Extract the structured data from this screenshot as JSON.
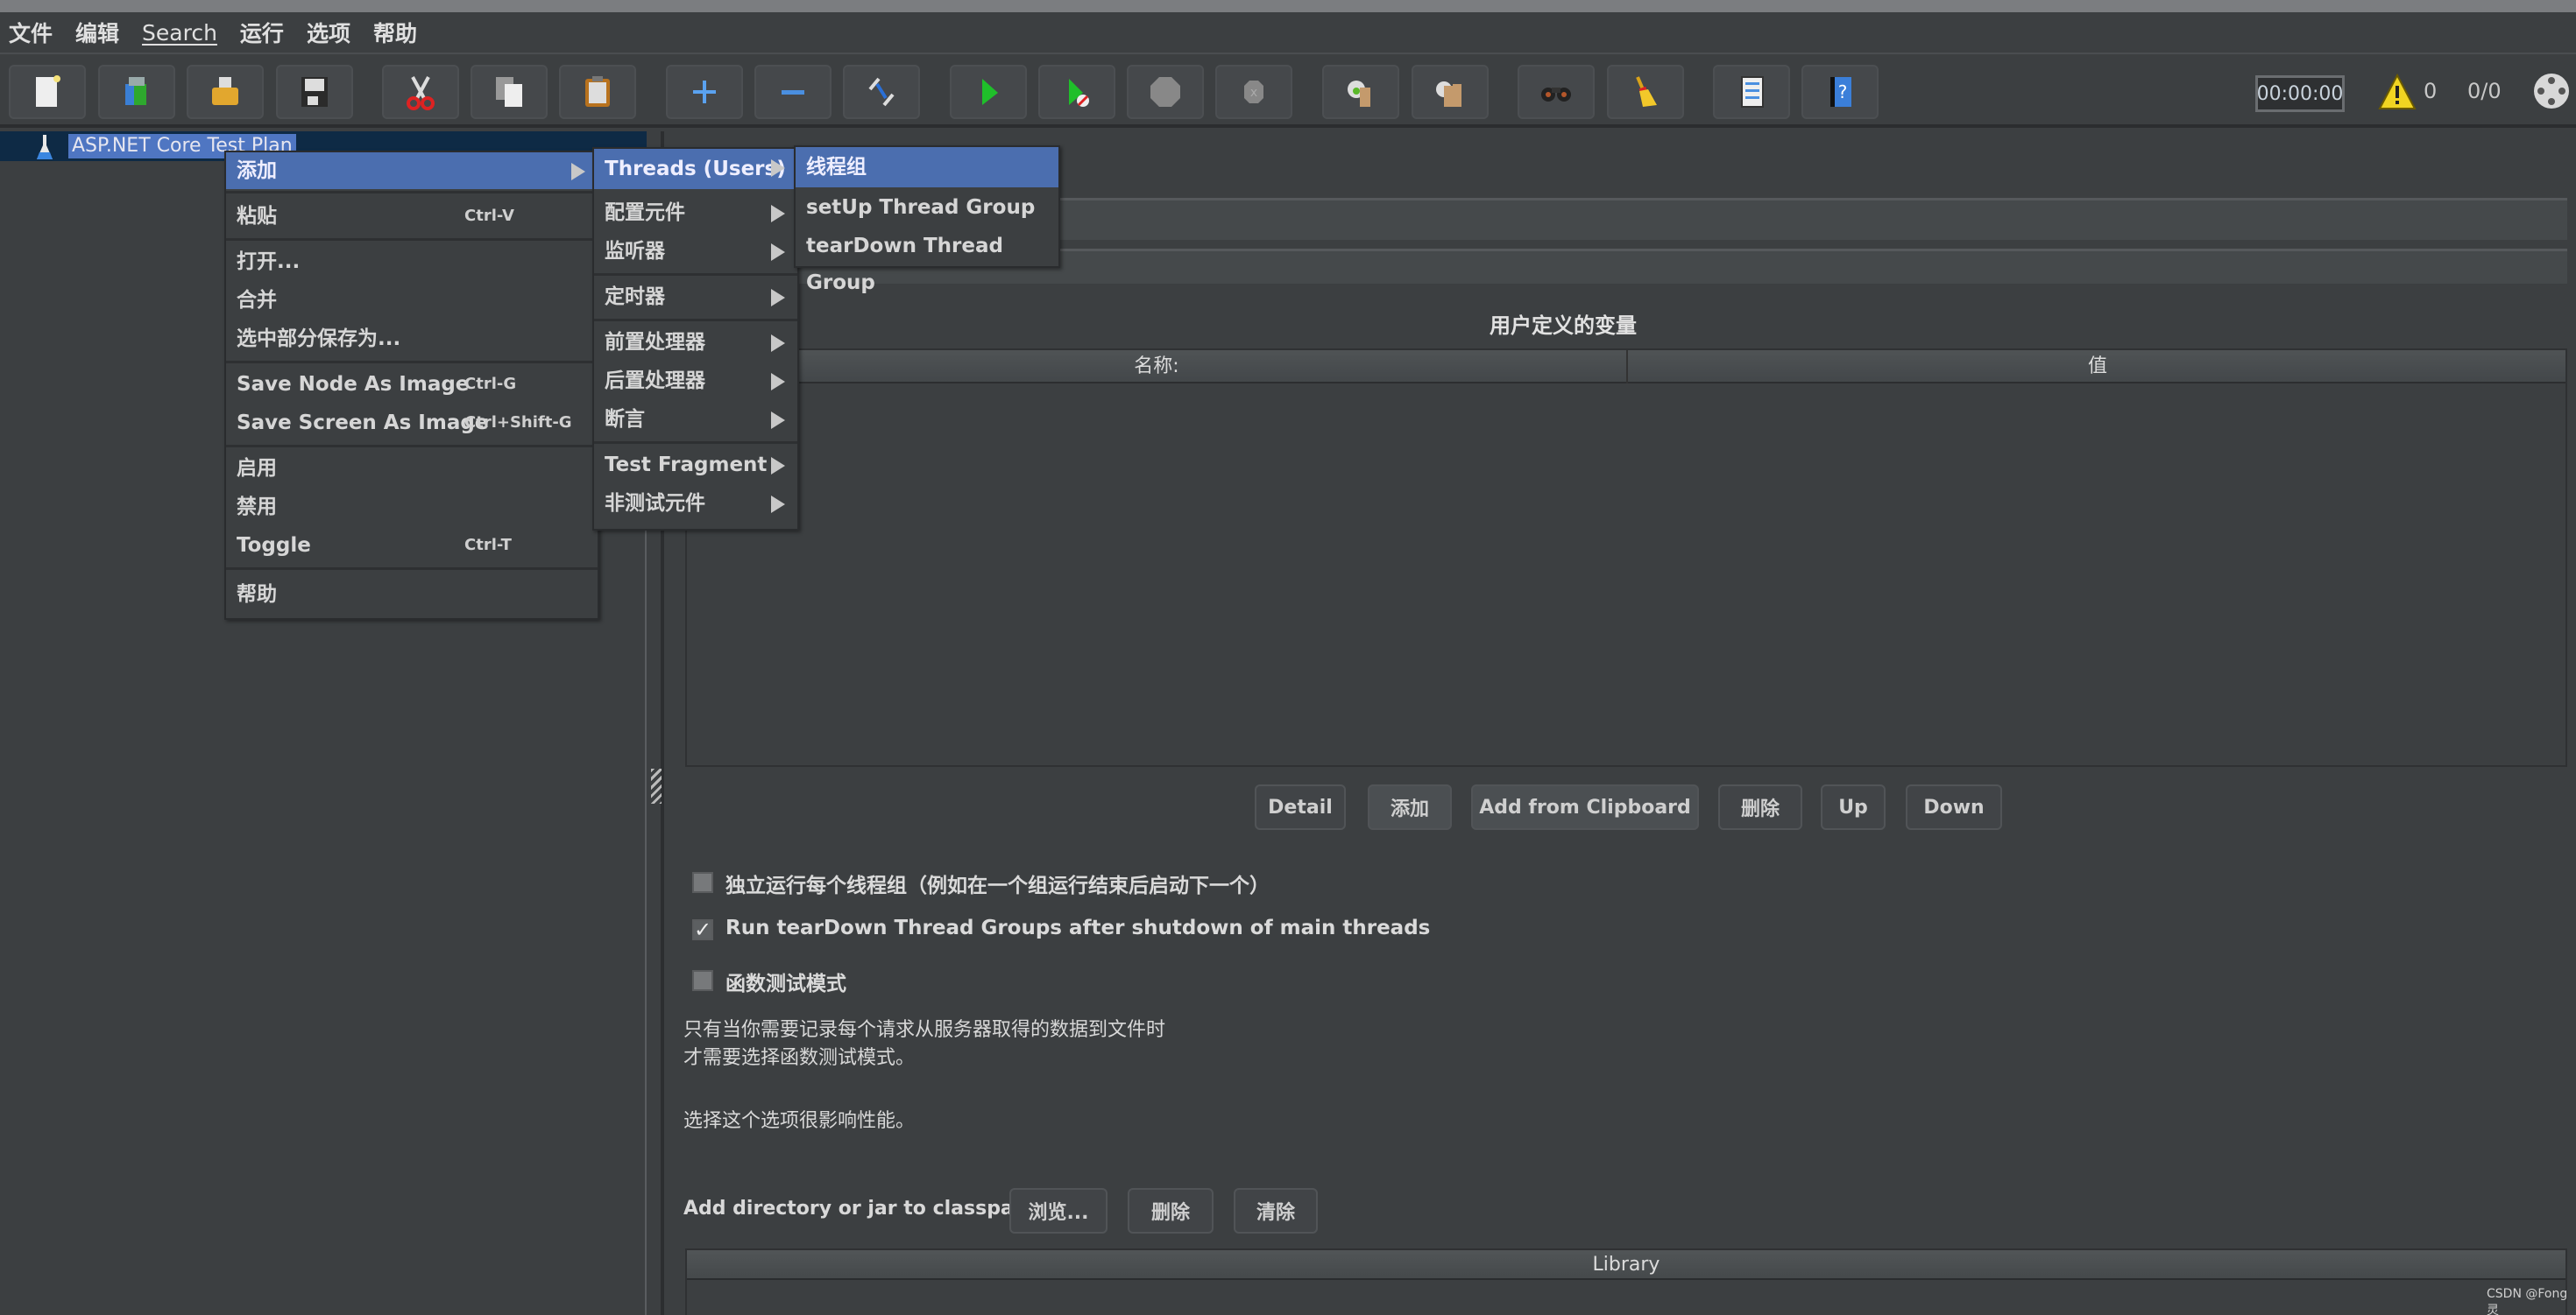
{
  "menubar": {
    "items": [
      "文件",
      "编辑",
      "Search",
      "运行",
      "选项",
      "帮助"
    ]
  },
  "toolbar": {
    "buttons": [
      {
        "name": "new",
        "icon": "new-document-icon"
      },
      {
        "name": "templates",
        "icon": "templates-icon"
      },
      {
        "name": "open",
        "icon": "open-folder-icon"
      },
      {
        "name": "save",
        "icon": "save-disk-icon"
      },
      {
        "name": "cut",
        "icon": "scissors-icon"
      },
      {
        "name": "copy",
        "icon": "copy-icon"
      },
      {
        "name": "paste",
        "icon": "clipboard-icon"
      },
      {
        "name": "expand-all",
        "icon": "plus-icon"
      },
      {
        "name": "collapse-all",
        "icon": "minus-icon"
      },
      {
        "name": "toggle",
        "icon": "toggle-wand-icon"
      },
      {
        "name": "start",
        "icon": "play-icon"
      },
      {
        "name": "start-no-pauses",
        "icon": "play-no-timers-icon"
      },
      {
        "name": "stop",
        "icon": "stop-icon"
      },
      {
        "name": "shutdown",
        "icon": "shutdown-icon"
      },
      {
        "name": "clear",
        "icon": "clear-broom-gear-icon"
      },
      {
        "name": "clear-all",
        "icon": "clear-all-broom-icon"
      },
      {
        "name": "search",
        "icon": "binoculars-icon"
      },
      {
        "name": "reset-search",
        "icon": "broom-icon"
      },
      {
        "name": "function-helper",
        "icon": "function-list-icon"
      },
      {
        "name": "help",
        "icon": "help-book-icon"
      }
    ],
    "timer": "00:00:00",
    "warning_count": "0",
    "threads_ratio": "0/0"
  },
  "tree": {
    "root_label": "ASP.NET Core Test Plan"
  },
  "context_menu": {
    "items": [
      {
        "label": "添加",
        "shortcut": "",
        "submenu": true,
        "selected": true
      },
      {
        "label": "粘贴",
        "shortcut": "Ctrl-V"
      },
      {
        "label": "打开...",
        "shortcut": ""
      },
      {
        "label": "合并",
        "shortcut": ""
      },
      {
        "label": "选中部分保存为...",
        "shortcut": ""
      },
      {
        "label": "Save Node As Image",
        "shortcut": "Ctrl-G"
      },
      {
        "label": "Save Screen As Image",
        "shortcut": "Ctrl+Shift-G"
      },
      {
        "label": "启用",
        "shortcut": ""
      },
      {
        "label": "禁用",
        "shortcut": ""
      },
      {
        "label": "Toggle",
        "shortcut": "Ctrl-T"
      },
      {
        "label": "帮助",
        "shortcut": ""
      }
    ]
  },
  "add_submenu": {
    "items": [
      {
        "label": "Threads (Users)",
        "selected": true
      },
      {
        "label": "配置元件"
      },
      {
        "label": "监听器"
      },
      {
        "label": "定时器"
      },
      {
        "label": "前置处理器"
      },
      {
        "label": "后置处理器"
      },
      {
        "label": "断言"
      },
      {
        "label": "Test Fragment"
      },
      {
        "label": "非测试元件"
      }
    ]
  },
  "threads_submenu": {
    "items": [
      {
        "label": "线程组",
        "selected": true
      },
      {
        "label": "setUp Thread Group"
      },
      {
        "label": "tearDown Thread Group"
      }
    ]
  },
  "main": {
    "variables_title": "用户定义的变量",
    "table_headers": [
      "名称:",
      "值"
    ],
    "table_buttons": [
      "Detail",
      "添加",
      "Add from Clipboard",
      "删除",
      "Up",
      "Down"
    ],
    "options": [
      {
        "label": "独立运行每个线程组（例如在一个组运行结束后启动下一个）",
        "checked": false
      },
      {
        "label": "Run tearDown Thread Groups after shutdown of main threads",
        "checked": true
      },
      {
        "label": "函数测试模式",
        "checked": false
      }
    ],
    "note_line1": "只有当你需要记录每个请求从服务器取得的数据到文件时",
    "note_line2": "才需要选择函数测试模式。",
    "note_line3": "选择这个选项很影响性能。",
    "classpath_label": "Add directory or jar to classpath",
    "classpath_buttons": [
      "浏览...",
      "删除",
      "清除"
    ],
    "library_header": "Library"
  },
  "watermark": "CSDN @Fong灵"
}
